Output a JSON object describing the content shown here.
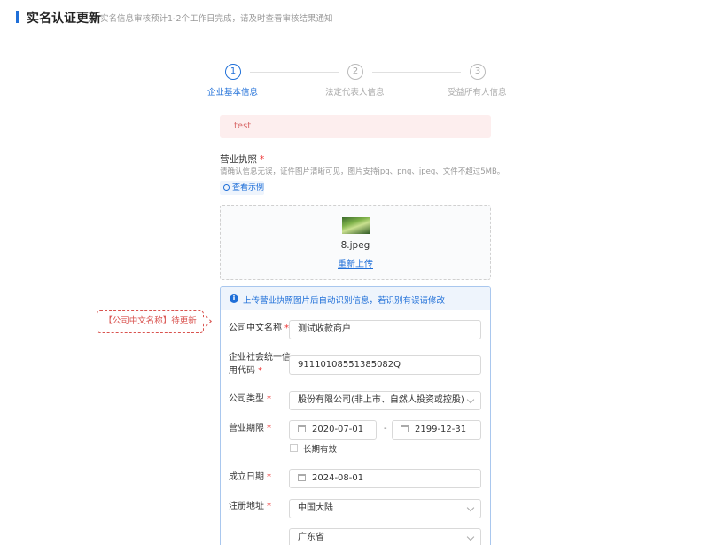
{
  "header": {
    "title": "实名认证更新",
    "subtitle": "实名信息审核预计1-2个工作日完成，请及时查看审核结果通知"
  },
  "steps": [
    {
      "number": "1",
      "label": "企业基本信息",
      "active": true
    },
    {
      "number": "2",
      "label": "法定代表人信息",
      "active": false
    },
    {
      "number": "3",
      "label": "受益所有人信息",
      "active": false
    }
  ],
  "alert": {
    "text": "test"
  },
  "license": {
    "title": "营业执照",
    "required_mark": "*",
    "hint": "请确认信息无误，证件图片清晰可见，图片支持jpg、png、jpeg、文件不超过5MB。",
    "example_label": "查看示例",
    "file_name": "8.jpeg",
    "reupload_label": "重新上传"
  },
  "form": {
    "info": "上传营业执照图片后自动识别信息，若识别有误请修改",
    "company_name": {
      "label": "公司中文名称",
      "value": "测试收款商户"
    },
    "credit_code": {
      "label_line1": "企业社会统一信",
      "label_line2": "用代码",
      "value": "91110108551385082Q"
    },
    "company_type": {
      "label": "公司类型",
      "value": "股份有限公司(非上市、自然人投资或控股)"
    },
    "business_term": {
      "label": "营业期限",
      "start": "2020-07-01",
      "separator": "-",
      "end": "2199-12-31",
      "long_term_label": "长期有效"
    },
    "established": {
      "label": "成立日期",
      "value": "2024-08-01"
    },
    "address": {
      "label": "注册地址",
      "country": "中国大陆",
      "province": "广东省"
    }
  },
  "callout": {
    "text": "【公司中文名称】待更新"
  },
  "colors": {
    "accent": "#1f6fd8",
    "error": "#d9534f",
    "alert_bg": "#fdeeee"
  }
}
